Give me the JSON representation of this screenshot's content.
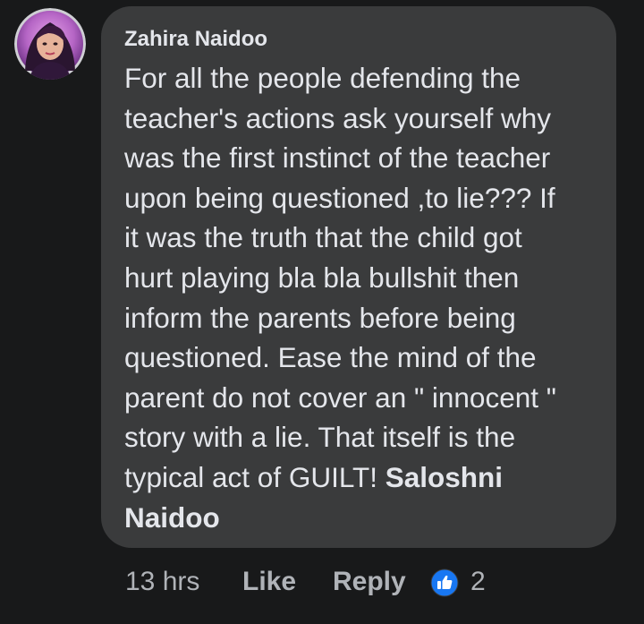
{
  "comment": {
    "author": "Zahira Naidoo",
    "avatar_icon": "profile-photo",
    "lines": [
      "For all the people defending the",
      "teacher's actions ask yourself why",
      "was the first instinct of the teacher",
      "upon being questioned ,to lie???  If",
      "it was the truth that the child got",
      "hurt playing bla bla bullshit then",
      "inform the parents before being",
      "questioned.  Ease the mind of the",
      "parent do not cover an \" innocent \"",
      "story with a lie. That itself is the",
      "typical act of GUILT! "
    ],
    "mention_part1": "Saloshni",
    "mention_part2": "Naidoo"
  },
  "actions": {
    "timestamp": "13 hrs",
    "like_label": "Like",
    "reply_label": "Reply",
    "reaction_icon": "thumbs-up-icon",
    "reaction_count": "2"
  },
  "colors": {
    "background": "#18191a",
    "bubble": "#3a3b3c",
    "text": "#e4e6eb",
    "secondary_text": "#b0b3b8",
    "like_blue": "#1877f2"
  }
}
